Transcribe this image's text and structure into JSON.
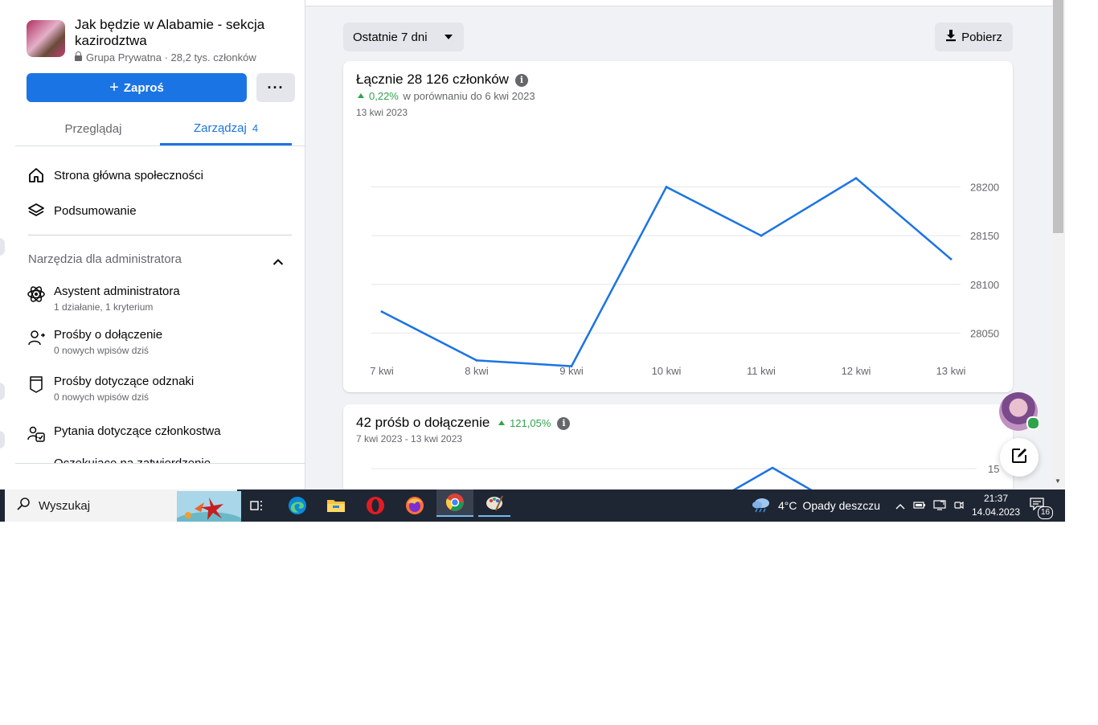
{
  "group": {
    "name": "Jak będzie w Alabamie - sekcja kazirodztwa",
    "privacy": "Grupa Prywatna",
    "separator": "·",
    "members_short": "28,2 tys. członków",
    "invite_label": "Zaproś",
    "more_label": "···"
  },
  "tabs": {
    "browse": "Przeglądaj",
    "manage": "Zarządzaj",
    "manage_count": "4"
  },
  "nav": {
    "community_home": "Strona główna społeczności",
    "overview": "Podsumowanie"
  },
  "admin_tools": {
    "heading": "Narzędzia dla administratora",
    "items": [
      {
        "label": "Asystent administratora",
        "sub": "1 działanie, 1 kryterium",
        "icon": "atom-icon"
      },
      {
        "label": "Prośby o dołączenie",
        "sub": "0 nowych wpisów dziś",
        "icon": "person-request-icon"
      },
      {
        "label": "Prośby dotyczące odznaki",
        "sub": "0 nowych wpisów dziś",
        "icon": "badge-icon"
      },
      {
        "label": "Pytania dotyczące członkostwa",
        "sub": "",
        "icon": "questions-icon"
      },
      {
        "label": "Oczekujące na zatwierdzenie",
        "sub": "",
        "icon": ""
      }
    ]
  },
  "toolbar": {
    "range_label": "Ostatnie 7 dni",
    "download_label": "Pobierz"
  },
  "members_card": {
    "title": "Łącznie 28 126 członków",
    "delta_pct": "0,22%",
    "delta_text": "w porównaniu do 6 kwi 2023",
    "date": "13 kwi 2023"
  },
  "requests_card": {
    "title": "42 próśb o dołączenie",
    "delta_pct": "121,05%",
    "date_range": "7 kwi 2023 - 13 kwi 2023",
    "y_tick_visible": "15"
  },
  "chart_data": [
    {
      "type": "line",
      "title": "Łącznie 28 126 członków",
      "x": [
        "7 kwi",
        "8 kwi",
        "9 kwi",
        "10 kwi",
        "11 kwi",
        "12 kwi",
        "13 kwi"
      ],
      "series": [
        {
          "values": [
            28072,
            28022,
            28016,
            28200,
            28150,
            28209,
            28126
          ]
        }
      ],
      "yticks": [
        28050,
        28100,
        28150,
        28200
      ],
      "ylim": [
        28000,
        28250
      ],
      "grid": true,
      "color": "#1b74e4"
    },
    {
      "type": "line",
      "title": "42 próśb o dołączenie",
      "yticks": [
        15
      ],
      "color": "#1b74e4"
    }
  ],
  "taskbar": {
    "search_placeholder": "Wyszukaj",
    "weather_temp": "4°C",
    "weather_text": "Opady deszczu",
    "time": "21:37",
    "date": "14.04.2023",
    "notifications": "16"
  },
  "colors": {
    "accent": "#1b74e4",
    "positive": "#31a24c",
    "taskbar": "#1f2633"
  }
}
